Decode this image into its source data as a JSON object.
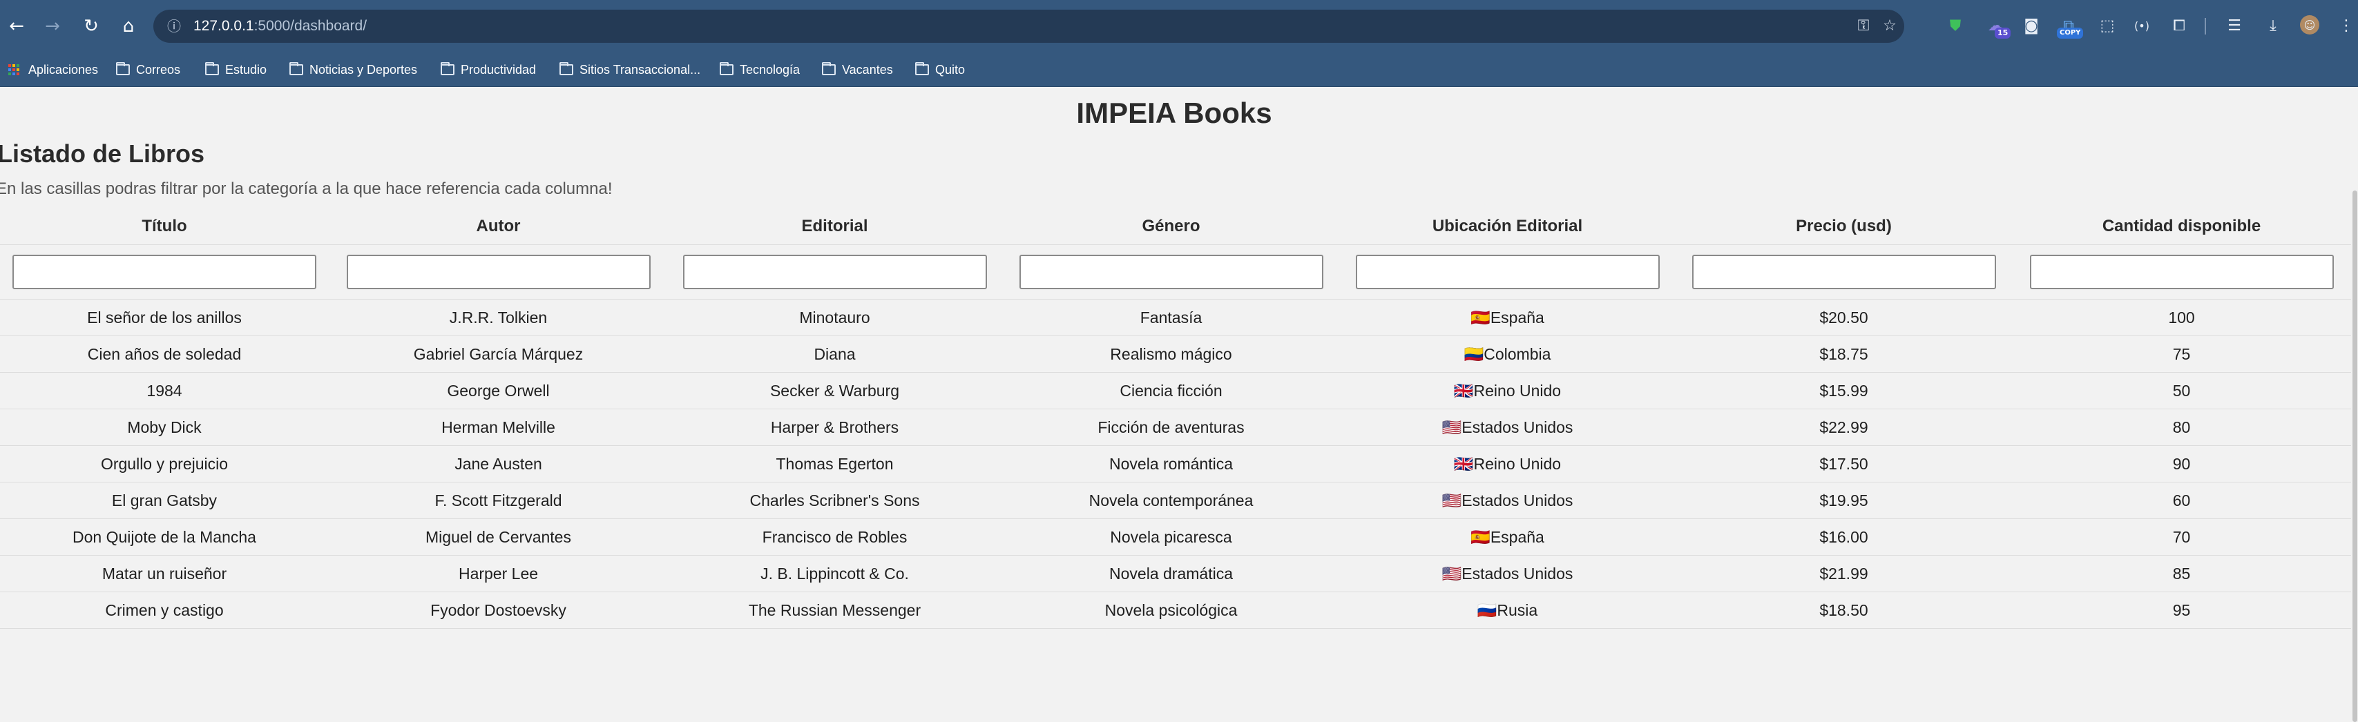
{
  "browser": {
    "url_host": "127.0.0.1",
    "url_path": ":5000/dashboard/",
    "extension_badge": "15",
    "copy_badge": "COPY"
  },
  "bookmarks": [
    {
      "label": "Aplicaciones",
      "icon": "apps-grid-icon"
    },
    {
      "label": "Correos",
      "icon": "folder-icon"
    },
    {
      "label": "Estudio",
      "icon": "folder-icon"
    },
    {
      "label": "Noticias y Deportes",
      "icon": "folder-icon"
    },
    {
      "label": "Productividad",
      "icon": "folder-icon"
    },
    {
      "label": "Sitios Transaccional...",
      "icon": "folder-icon"
    },
    {
      "label": "Tecnología",
      "icon": "folder-icon"
    },
    {
      "label": "Vacantes",
      "icon": "folder-icon"
    },
    {
      "label": "Quito",
      "icon": "folder-icon"
    }
  ],
  "page": {
    "title": "IMPEIA Books",
    "section_title": "Listado de Libros",
    "subtitle": "En las casillas podras filtrar por la categoría a la que hace referencia cada columna!"
  },
  "table": {
    "headers": [
      "Título",
      "Autor",
      "Editorial",
      "Género",
      "Ubicación Editorial",
      "Precio (usd)",
      "Cantidad disponible"
    ],
    "filters": [
      "",
      "",
      "",
      "",
      "",
      "",
      ""
    ],
    "rows": [
      {
        "titulo": "El señor de los anillos",
        "autor": "J.R.R. Tolkien",
        "editorial": "Minotauro",
        "genero": "Fantasía",
        "flag": "🇪🇸",
        "pais": "España",
        "precio": "$20.50",
        "cantidad": "100"
      },
      {
        "titulo": "Cien años de soledad",
        "autor": "Gabriel García Márquez",
        "editorial": "Diana",
        "genero": "Realismo mágico",
        "flag": "🇨🇴",
        "pais": "Colombia",
        "precio": "$18.75",
        "cantidad": "75"
      },
      {
        "titulo": "1984",
        "autor": "George Orwell",
        "editorial": "Secker & Warburg",
        "genero": "Ciencia ficción",
        "flag": "🇬🇧",
        "pais": "Reino Unido",
        "precio": "$15.99",
        "cantidad": "50"
      },
      {
        "titulo": "Moby Dick",
        "autor": "Herman Melville",
        "editorial": "Harper & Brothers",
        "genero": "Ficción de aventuras",
        "flag": "🇺🇸",
        "pais": "Estados Unidos",
        "precio": "$22.99",
        "cantidad": "80"
      },
      {
        "titulo": "Orgullo y prejuicio",
        "autor": "Jane Austen",
        "editorial": "Thomas Egerton",
        "genero": "Novela romántica",
        "flag": "🇬🇧",
        "pais": "Reino Unido",
        "precio": "$17.50",
        "cantidad": "90"
      },
      {
        "titulo": "El gran Gatsby",
        "autor": "F. Scott Fitzgerald",
        "editorial": "Charles Scribner's Sons",
        "genero": "Novela contemporánea",
        "flag": "🇺🇸",
        "pais": "Estados Unidos",
        "precio": "$19.95",
        "cantidad": "60"
      },
      {
        "titulo": "Don Quijote de la Mancha",
        "autor": "Miguel de Cervantes",
        "editorial": "Francisco de Robles",
        "genero": "Novela picaresca",
        "flag": "🇪🇸",
        "pais": "España",
        "precio": "$16.00",
        "cantidad": "70"
      },
      {
        "titulo": "Matar un ruiseñor",
        "autor": "Harper Lee",
        "editorial": "J. B. Lippincott & Co.",
        "genero": "Novela dramática",
        "flag": "🇺🇸",
        "pais": "Estados Unidos",
        "precio": "$21.99",
        "cantidad": "85"
      },
      {
        "titulo": "Crimen y castigo",
        "autor": "Fyodor Dostoevsky",
        "editorial": "The Russian Messenger",
        "genero": "Novela psicológica",
        "flag": "🇷🇺",
        "pais": "Rusia",
        "precio": "$18.50",
        "cantidad": "95"
      }
    ]
  },
  "colors": {
    "chrome_bg": "#35587e",
    "omnibox_bg": "#243a55",
    "page_bg": "#f2f2f2",
    "row_border": "#dddddd"
  }
}
